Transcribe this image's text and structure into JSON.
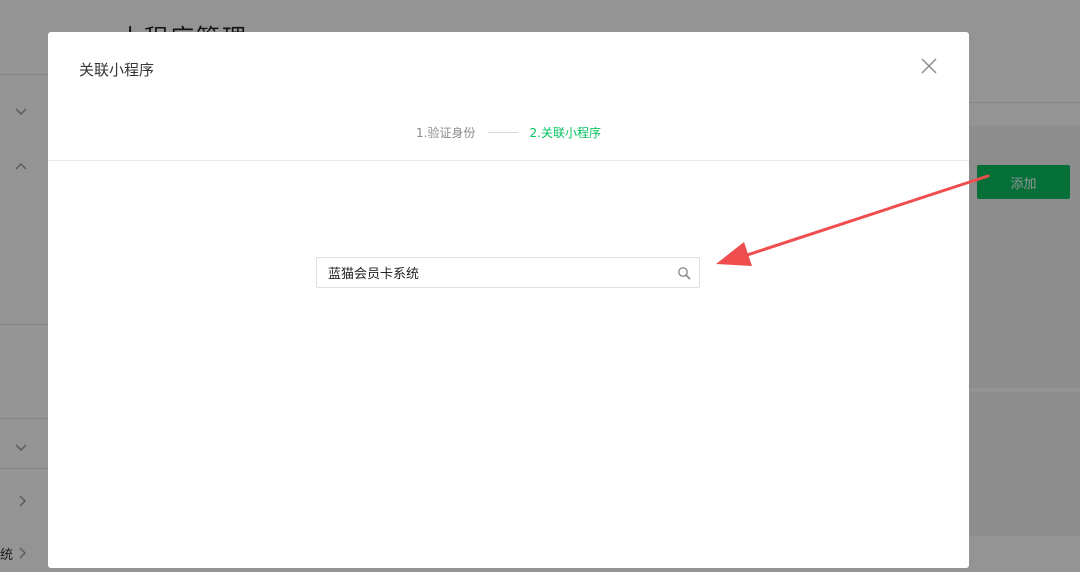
{
  "background": {
    "page_title": "小程序管理",
    "left_partial_text": "统",
    "add_button_label": "添加"
  },
  "dialog": {
    "title": "关联小程序",
    "close_icon": "close-icon",
    "steps": [
      {
        "label": "1.验证身份",
        "state": "done"
      },
      {
        "label": "2.关联小程序",
        "state": "active"
      }
    ],
    "search": {
      "value": "蓝猫会员卡系统",
      "placeholder": "",
      "icon": "search-icon"
    }
  },
  "annotation": {
    "arrow_color": "#f04e4e"
  },
  "colors": {
    "accent": "#07c160",
    "overlay": "rgba(0,0,0,0.42)"
  }
}
